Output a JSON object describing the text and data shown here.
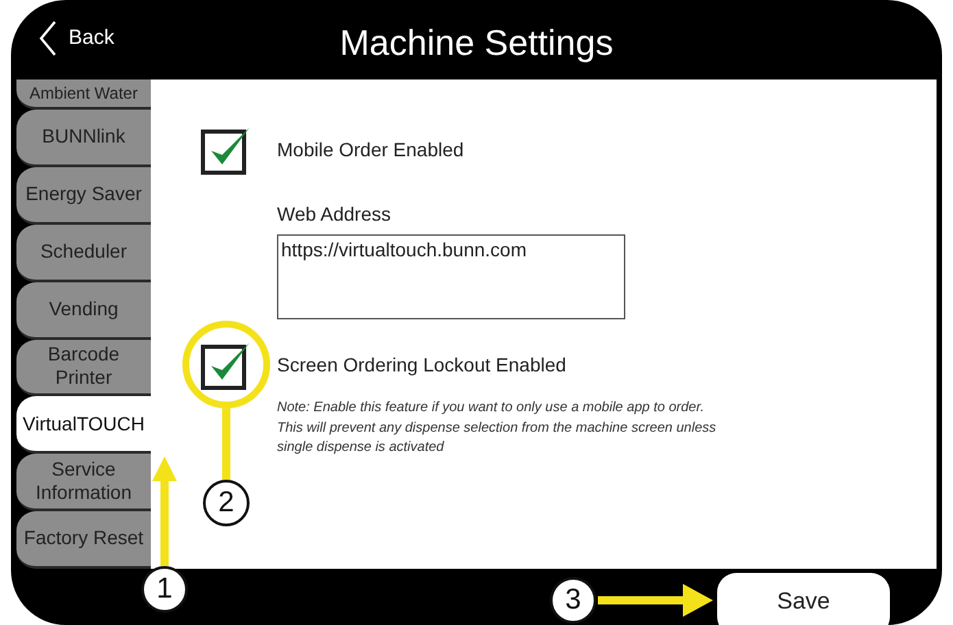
{
  "header": {
    "back": "Back",
    "title": "Machine Settings"
  },
  "sidebar": {
    "items": [
      {
        "label": "Ambient Water",
        "selected": false
      },
      {
        "label": "BUNNlink",
        "selected": false
      },
      {
        "label": "Energy Saver",
        "selected": false
      },
      {
        "label": "Scheduler",
        "selected": false
      },
      {
        "label": "Vending",
        "selected": false
      },
      {
        "label": "Barcode Printer",
        "selected": false
      },
      {
        "label": "VirtualTOUCH",
        "selected": true
      },
      {
        "label": "Service Information",
        "selected": false
      },
      {
        "label": "Factory Reset",
        "selected": false
      }
    ]
  },
  "settings": [
    {
      "kind": "checkbox",
      "label": "Mobile Order Enabled",
      "checked": true
    },
    {
      "kind": "field",
      "label": "Web Address",
      "value": "https://virtualtouch.bunn.com"
    },
    {
      "kind": "checkbox",
      "label": "Screen Ordering Lockout Enabled",
      "checked": true
    },
    {
      "kind": "note",
      "text": "Note:  Enable this feature if you want to only use a mobile app to order.  This will prevent any dispense selection from the machine screen unless single dispense is activated"
    }
  ],
  "save": "Save",
  "callouts": [
    "1",
    "2",
    "3"
  ]
}
